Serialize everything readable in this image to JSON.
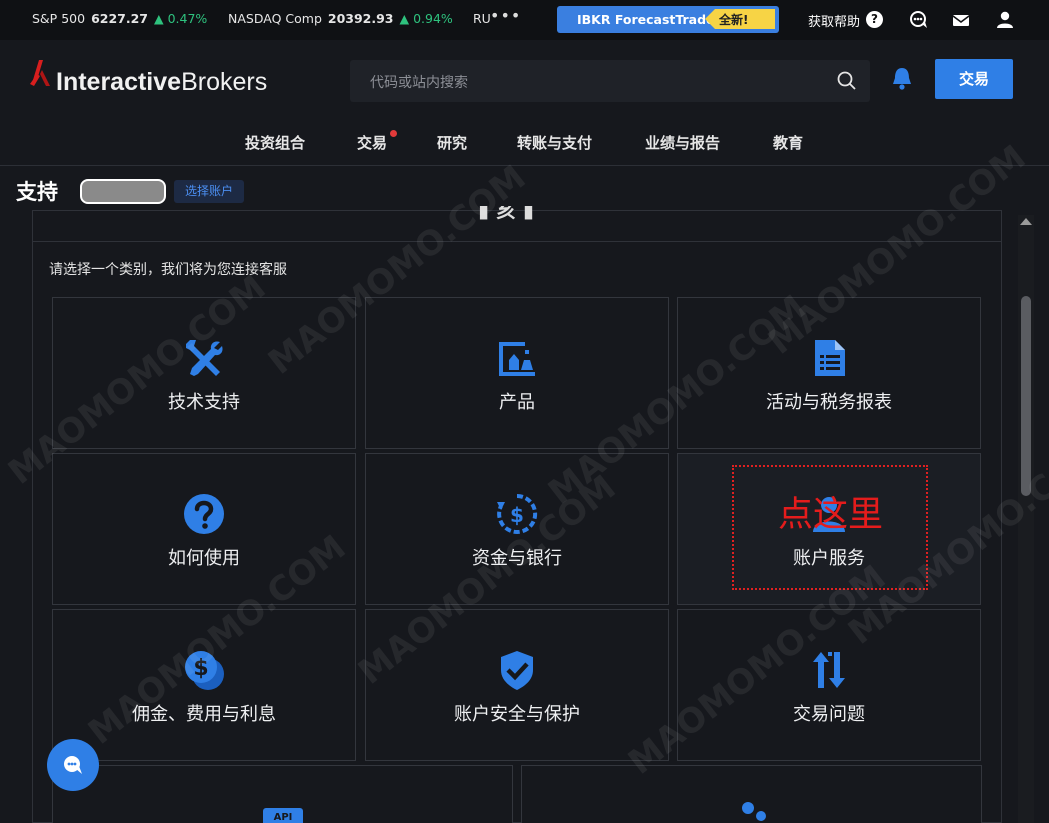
{
  "ticker": [
    {
      "name": "S&P 500",
      "value": "6227.27",
      "change": "▲ 0.47%"
    },
    {
      "name": "NASDAQ Comp",
      "value": "20392.93",
      "change": "▲ 0.94%"
    },
    {
      "name": "RU",
      "value": "",
      "change": ""
    }
  ],
  "ticker_more": "•••",
  "promo": {
    "label": "IBKR ForecastTrader",
    "badge": "全新!"
  },
  "help": {
    "label": "获取帮助",
    "icon": "help-icon"
  },
  "logo": {
    "part1": "Interactive",
    "part2": "Brokers"
  },
  "search": {
    "placeholder": "代码或站内搜索"
  },
  "trade_button": "交易",
  "nav": [
    {
      "label": "投资组合"
    },
    {
      "label": "交易"
    },
    {
      "label": "研究"
    },
    {
      "label": "转账与支付"
    },
    {
      "label": "业绩与报告"
    },
    {
      "label": "教育"
    }
  ],
  "page_title": "支持",
  "select_account": "选择账户",
  "panel": {
    "heading_partial": "▮ 亥 ▮",
    "prompt": "请选择一个类别，我们将为您连接客服"
  },
  "categories": [
    {
      "label": "技术支持",
      "icon": "tools-icon"
    },
    {
      "label": "产品",
      "icon": "products-icon"
    },
    {
      "label": "活动与税务报表",
      "icon": "document-icon"
    },
    {
      "label": "如何使用",
      "icon": "question-icon"
    },
    {
      "label": "资金与银行",
      "icon": "money-cycle-icon"
    },
    {
      "label": "账户服务",
      "icon": "account-user-icon"
    },
    {
      "label": "佣金、费用与利息",
      "icon": "coins-icon"
    },
    {
      "label": "账户安全与保护",
      "icon": "shield-check-icon"
    },
    {
      "label": "交易问题",
      "icon": "arrows-updown-icon"
    }
  ],
  "partial_row": [
    {
      "icon": "api-icon",
      "tag": "API"
    },
    {
      "icon": "people-icon"
    }
  ],
  "annotation": {
    "text": "点这里",
    "color": "#e41c1c"
  },
  "watermark": "MAOMOMO.COM",
  "colors": {
    "accent": "#2f7fe6",
    "background": "#16181d",
    "positive": "#2ec27e",
    "promo_badge": "#f7d445"
  }
}
